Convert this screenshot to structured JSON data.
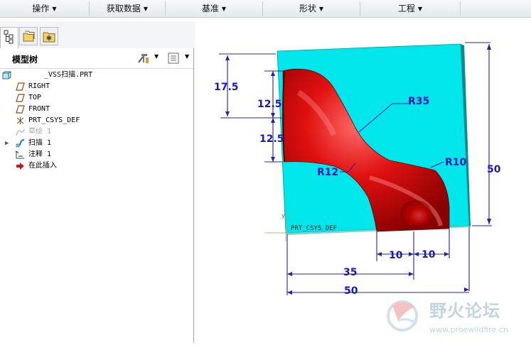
{
  "menubar": {
    "items": [
      {
        "label": "操作"
      },
      {
        "label": "获取数据"
      },
      {
        "label": "基准"
      },
      {
        "label": "形状"
      },
      {
        "label": "工程"
      }
    ]
  },
  "model_tree": {
    "title": "模型树",
    "root": "_VSS扫描.PRT",
    "items": [
      {
        "label": "RIGHT",
        "icon": "datum-plane-icon"
      },
      {
        "label": "TOP",
        "icon": "datum-plane-icon"
      },
      {
        "label": "FRONT",
        "icon": "datum-plane-icon"
      },
      {
        "label": "PRT_CSYS_DEF",
        "icon": "coordinate-system-icon"
      },
      {
        "label": "草绘 1",
        "icon": "sketch-icon",
        "state": "suppressed"
      },
      {
        "label": "扫描 1",
        "icon": "sweep-icon",
        "expandable": true
      },
      {
        "label": "注释 1",
        "icon": "annotation-icon"
      },
      {
        "label": "在此插入",
        "icon": "insert-here-arrow-icon"
      }
    ]
  },
  "viewport": {
    "csys_label": "PRT_CSYS_DEF",
    "dimensions": {
      "d_17_5": "17.5",
      "d_12_5_top": "12.5",
      "d_12_5_bottom": "12.5",
      "d_r35": "R35",
      "d_r12": "R12",
      "d_r10": "R10",
      "d_50_right": "50",
      "d_10_left": "10",
      "d_10_right": "10",
      "d_35": "35",
      "d_50_bottom": "50"
    },
    "colors": {
      "plate": "#00e8e8",
      "sweep": "#d40000",
      "dimensions": "#1a1ab0"
    }
  },
  "watermark": {
    "brand": "野火论坛",
    "url": "www.proewildfire.cn"
  }
}
